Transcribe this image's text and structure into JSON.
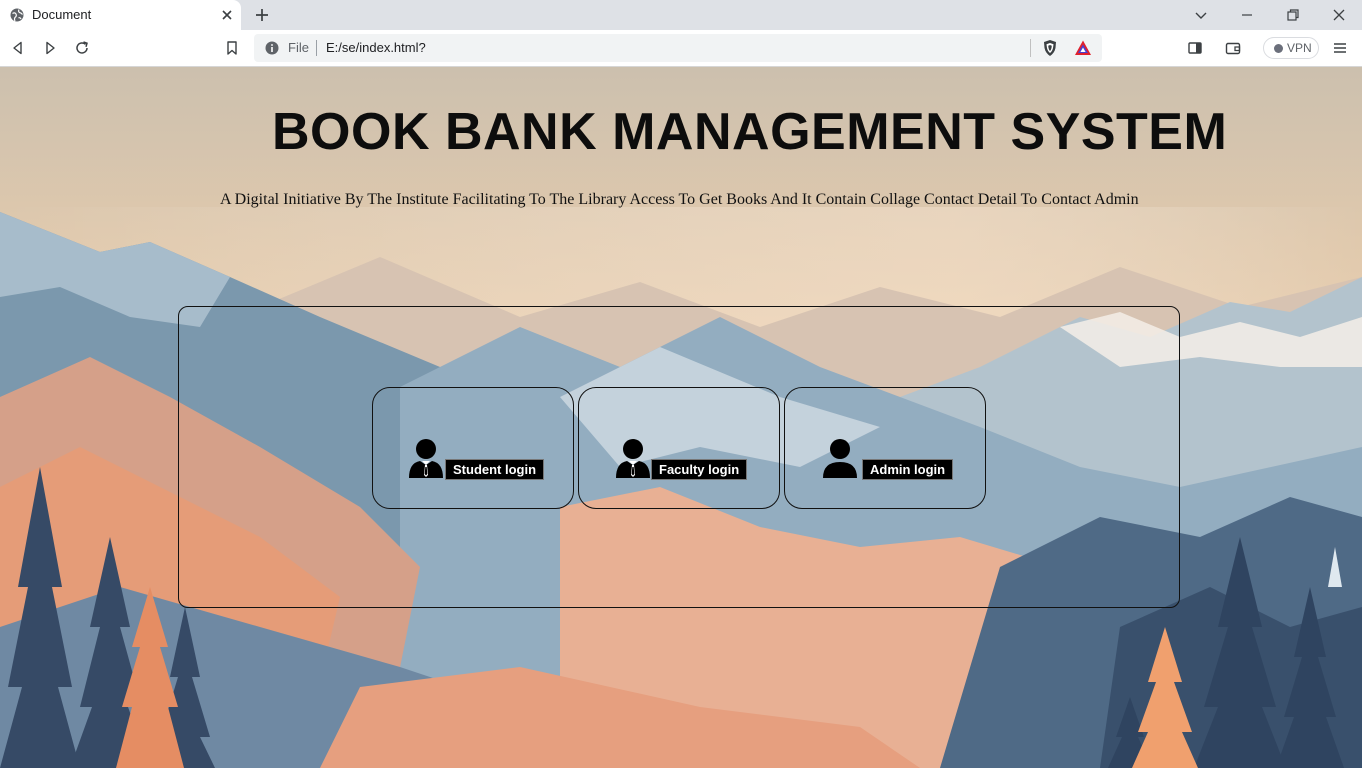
{
  "browser": {
    "tab_title": "Document",
    "address_scheme": "File",
    "url": "E:/se/index.html?",
    "vpn_label": "VPN"
  },
  "page": {
    "title": "BOOK BANK MANAGEMENT SYSTEM",
    "subtitle": "A Digital Initiative By The Institute Facilitating To The Library Access To Get Books And It Contain Collage Contact Detail To Contact Admin"
  },
  "logins": [
    {
      "label": "Student login",
      "icon": "person-tie-icon"
    },
    {
      "label": "Faculty login",
      "icon": "person-tie-icon"
    },
    {
      "label": "Admin login",
      "icon": "person-icon"
    }
  ],
  "colors": {
    "title_text": "#0d0d0d",
    "login_button_bg": "#000000",
    "login_button_text": "#ffffff"
  }
}
